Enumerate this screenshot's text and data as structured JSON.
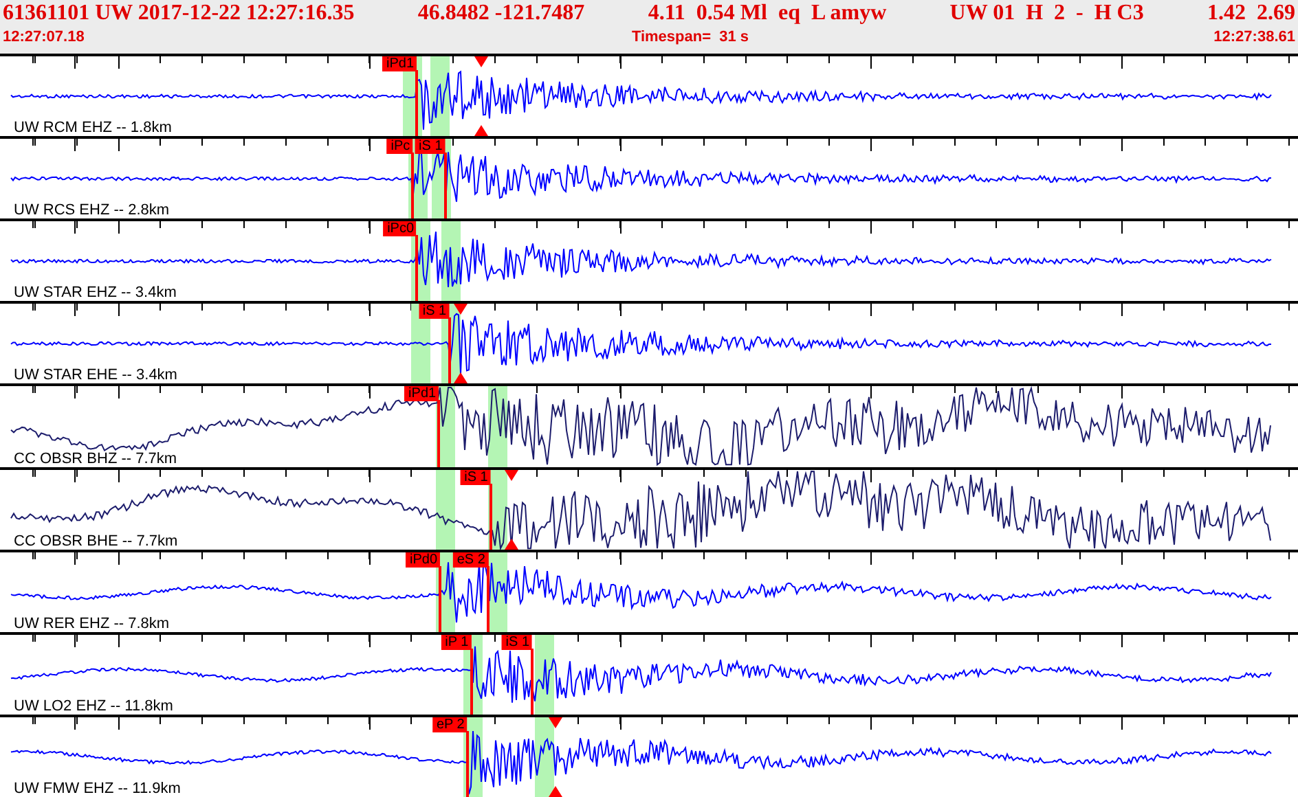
{
  "header": {
    "fields": [
      "61361101 UW 2017-12-22 12:27:16.35",
      "46.8482 -121.7487",
      "4.11  0.54 Ml  eq  L amyw",
      "UW 01  H  2  -  H C3",
      "1.42  2.69"
    ],
    "start_time": "12:27:07.18",
    "timespan": "Timespan=  31 s",
    "end_time": "12:27:38.61"
  },
  "traces": [
    {
      "label": "UW RCM EHZ -- 1.8km",
      "kind": "short-period",
      "color": "#0000ff",
      "picks": [
        {
          "text": "iPd1",
          "level": 0.321
        }
      ],
      "windows": [
        {
          "level": 0.318
        },
        {
          "level": 0.339
        }
      ],
      "marker": {
        "level": 0.371
      }
    },
    {
      "label": "UW RCS EHZ -- 2.8km",
      "kind": "short-period",
      "color": "#0000ff",
      "picks": [
        {
          "text": "iPc",
          "level": 0.318
        },
        {
          "text": "iS 1",
          "level": 0.343
        }
      ],
      "windows": [
        {
          "level": 0.322
        },
        {
          "level": 0.34
        }
      ]
    },
    {
      "label": "UW STAR EHZ -- 3.4km",
      "kind": "short-period",
      "color": "#0000ff",
      "picks": [
        {
          "text": "iPc0",
          "level": 0.321
        }
      ],
      "windows": [
        {
          "level": 0.324
        },
        {
          "level": 0.347
        }
      ]
    },
    {
      "label": "UW STAR EHE -- 3.4km",
      "kind": "short-period",
      "color": "#0000ff",
      "picks": [
        {
          "text": "iS 1",
          "level": 0.346
        }
      ],
      "windows": [
        {
          "level": 0.324
        },
        {
          "level": 0.347
        }
      ],
      "marker": {
        "level": 0.355
      }
    },
    {
      "label": "CC OBSR BHZ -- 7.7km",
      "kind": "broadband",
      "color": "#1c1c6c",
      "picks": [
        {
          "text": "iPd1",
          "level": 0.338
        }
      ],
      "windows": [
        {
          "level": 0.343
        },
        {
          "level": 0.383
        }
      ]
    },
    {
      "label": "CC OBSR BHE -- 7.7km",
      "kind": "broadband",
      "color": "#1c1c6c",
      "picks": [
        {
          "text": "iS 1",
          "level": 0.378
        }
      ],
      "windows": [
        {
          "level": 0.343
        },
        {
          "level": 0.383
        }
      ],
      "marker": {
        "level": 0.394
      }
    },
    {
      "label": "UW RER EHZ -- 7.8km",
      "kind": "short-period",
      "color": "#0000ff",
      "picks": [
        {
          "text": "iPd0",
          "level": 0.339
        },
        {
          "text": "eS 2",
          "level": 0.376
        }
      ],
      "windows": [
        {
          "level": 0.343
        },
        {
          "level": 0.383
        }
      ]
    },
    {
      "label": "UW LO2 EHZ -- 11.8km",
      "kind": "short-period",
      "color": "#0000ff",
      "picks": [
        {
          "text": "iP 1",
          "level": 0.363
        },
        {
          "text": "iS 1",
          "level": 0.41
        }
      ],
      "windows": [
        {
          "level": 0.364
        },
        {
          "level": 0.42
        }
      ]
    },
    {
      "label": "UW FMW EHZ -- 11.9km",
      "kind": "short-period",
      "color": "#0000ff",
      "picks": [
        {
          "text": "eP 2",
          "level": 0.36
        }
      ],
      "windows": [
        {
          "level": 0.364
        },
        {
          "level": 0.42
        }
      ],
      "marker": {
        "level": 0.428
      }
    }
  ]
}
